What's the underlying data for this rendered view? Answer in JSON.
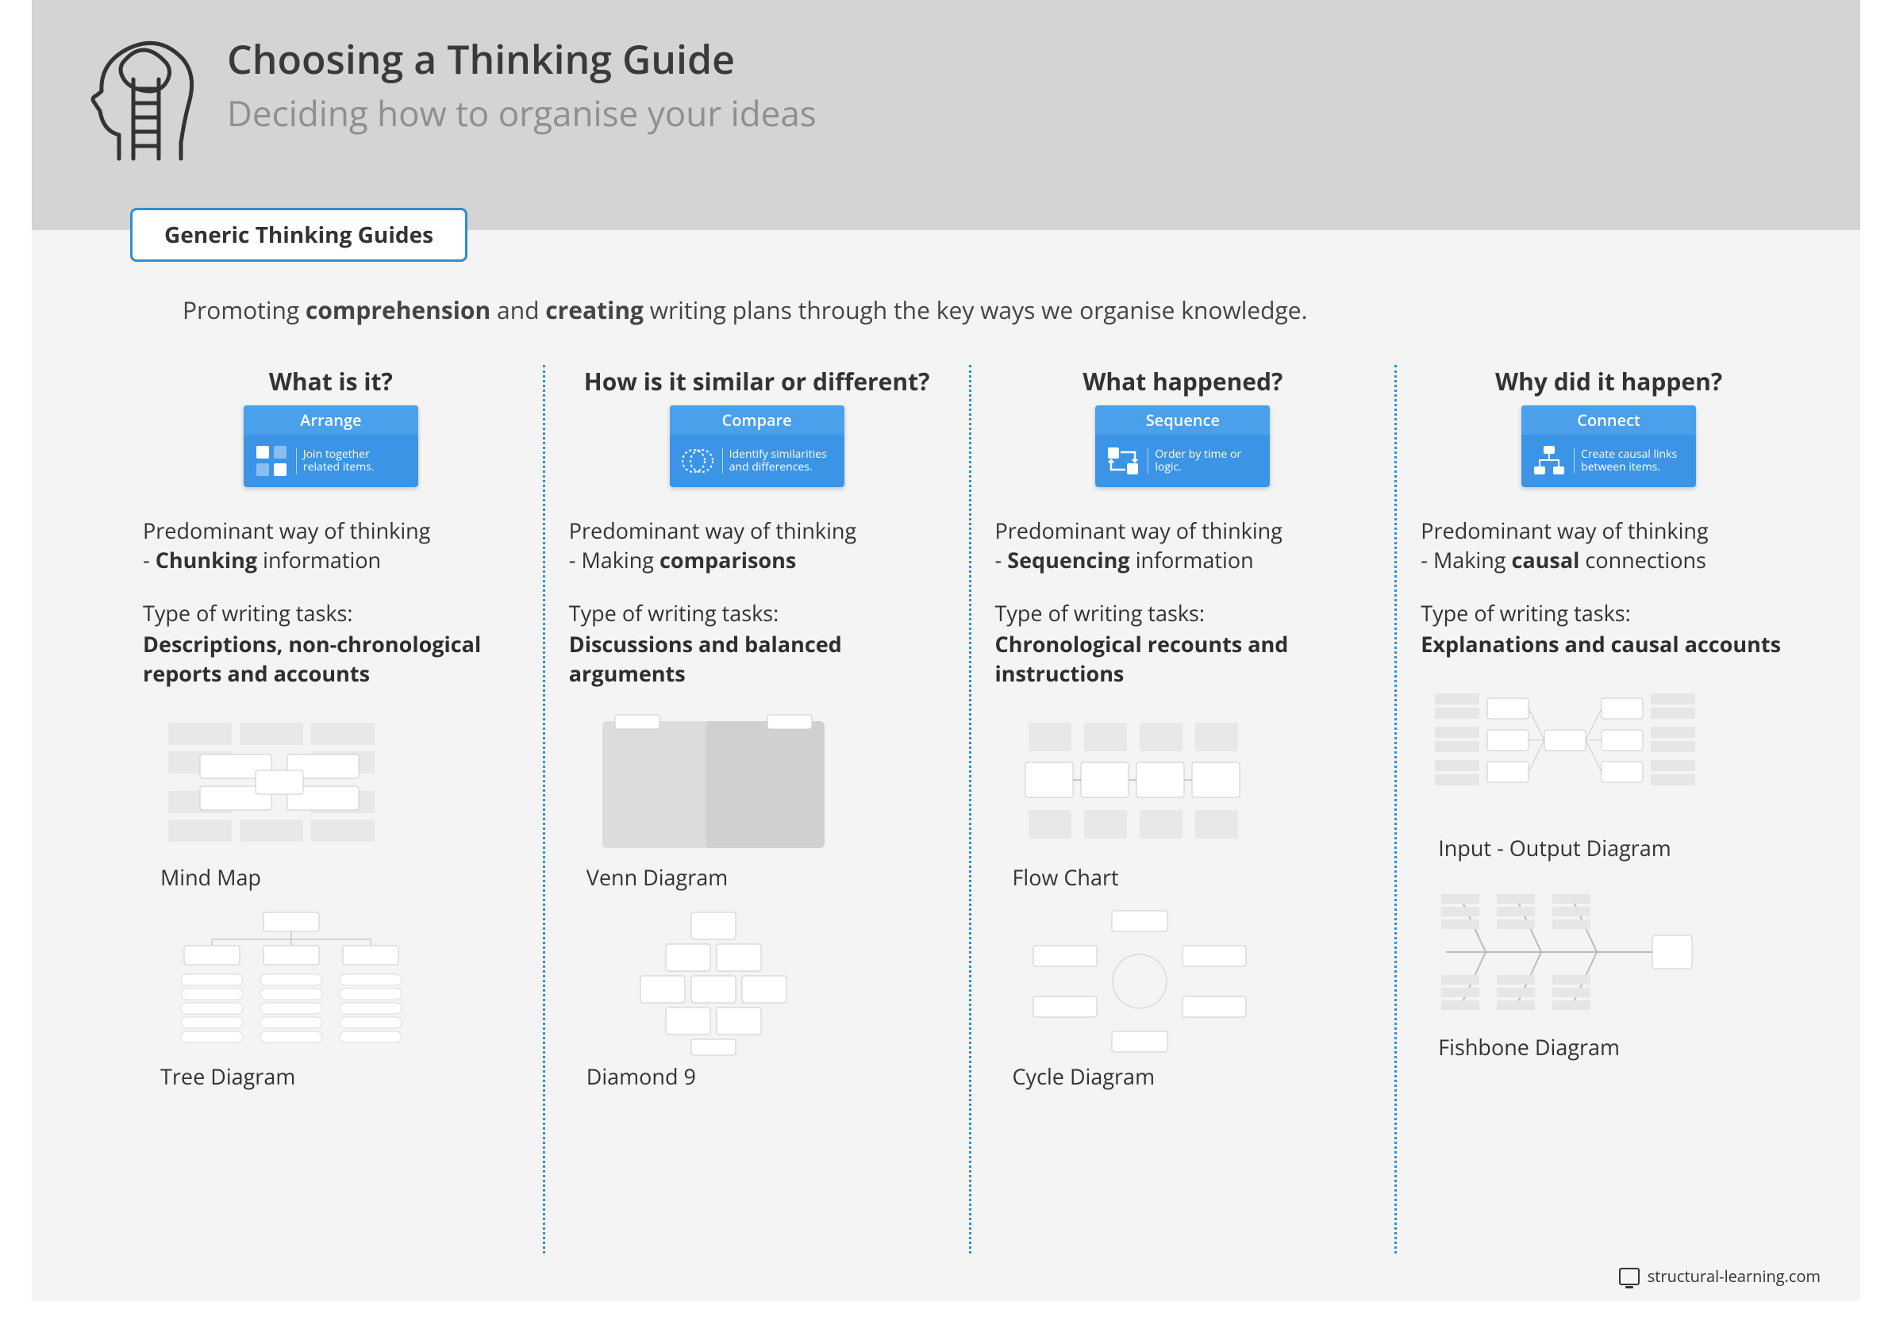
{
  "header": {
    "title": "Choosing a Thinking Guide",
    "subtitle": "Deciding how to organise your ideas"
  },
  "tab": "Generic Thinking Guides",
  "intro_parts": {
    "a": "Promoting ",
    "b": "comprehension",
    "c": " and ",
    "d": "creating",
    "e": " writing plans through the key ways we organise knowledge."
  },
  "columns": [
    {
      "question": "What is it?",
      "card_title": "Arrange",
      "card_text": "Join together related items.",
      "think_pre": "Predominant way of thinking",
      "think_line_a": "- ",
      "think_bold": "Chunking",
      "think_line_b": " information",
      "tasks_label": "Type of writing tasks:",
      "tasks": "Descriptions, non-chronological reports and accounts",
      "thumbs": [
        "Mind Map",
        "Tree Diagram"
      ]
    },
    {
      "question": "How is it similar or different?",
      "card_title": "Compare",
      "card_text": "Identify similarities and differences.",
      "think_pre": "Predominant way of thinking",
      "think_line_a": "- Making ",
      "think_bold": "comparisons",
      "think_line_b": "",
      "tasks_label": "Type of writing tasks:",
      "tasks": "Discussions and balanced arguments",
      "thumbs": [
        "Venn Diagram",
        "Diamond 9"
      ]
    },
    {
      "question": "What happened?",
      "card_title": "Sequence",
      "card_text": "Order by time or logic.",
      "think_pre": "Predominant way of thinking",
      "think_line_a": "- ",
      "think_bold": "Sequencing",
      "think_line_b": " information",
      "tasks_label": "Type of writing tasks:",
      "tasks": "Chronological recounts and instructions",
      "thumbs": [
        "Flow Chart",
        "Cycle Diagram"
      ]
    },
    {
      "question": "Why did it happen?",
      "card_title": "Connect",
      "card_text": "Create causal links between items.",
      "think_pre": "Predominant way of thinking",
      "think_line_a": "- Making ",
      "think_bold": "causal",
      "think_line_b": " connections",
      "tasks_label": "Type of writing tasks:",
      "tasks": "Explanations and causal accounts",
      "thumbs": [
        "Input - Output Diagram",
        "Fishbone Diagram"
      ]
    }
  ],
  "footer": "structural-learning.com"
}
